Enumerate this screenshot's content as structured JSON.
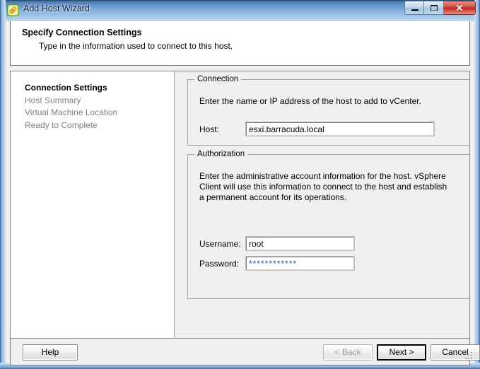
{
  "window": {
    "title": "Add Host Wizard",
    "icon": "wizard-link-icon",
    "controls": {
      "minimize": "minimize-icon",
      "maximize": "maximize-icon",
      "close_glyph": "✕",
      "close_color": "#bd2e25"
    }
  },
  "header": {
    "title": "Specify Connection Settings",
    "subtitle": "Type in the information used to connect to this host."
  },
  "steps": [
    {
      "label": "Connection Settings",
      "state": "active"
    },
    {
      "label": "Host Summary",
      "state": "inactive"
    },
    {
      "label": "Virtual Machine Location",
      "state": "inactive"
    },
    {
      "label": "Ready to Complete",
      "state": "inactive"
    }
  ],
  "connection_group": {
    "legend": "Connection",
    "description": "Enter the name or IP address of the host to add to vCenter.",
    "host": {
      "label": "Host:",
      "value": "esxi.barracuda.local",
      "placeholder": ""
    }
  },
  "authorization_group": {
    "legend": "Authorization",
    "description": "Enter the administrative account information for the host. vSphere Client will use this information to connect to the host and establish a permanent account for its operations.",
    "username": {
      "label": "Username:",
      "value": "root",
      "placeholder": ""
    },
    "password": {
      "label": "Password:",
      "value": "************",
      "placeholder": ""
    }
  },
  "footer": {
    "help": "Help",
    "back": "< Back",
    "next": "Next >",
    "cancel": "Cancel"
  }
}
